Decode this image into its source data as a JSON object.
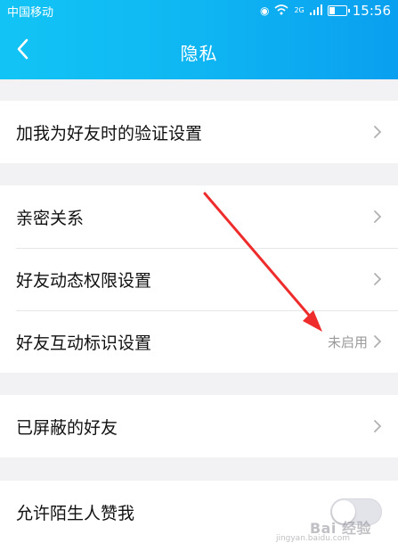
{
  "status_bar": {
    "carrier": "中国移动",
    "network": "2G",
    "time": "15:56"
  },
  "header": {
    "back_icon": "chevron-left-icon",
    "title": "隐私",
    "color_start": "#12c4f5",
    "color_end": "#0a9ff0"
  },
  "groups": [
    {
      "items": [
        {
          "label": "加我为好友时的验证设置",
          "chevron": true
        }
      ]
    },
    {
      "items": [
        {
          "label": "亲密关系",
          "chevron": true
        },
        {
          "label": "好友动态权限设置",
          "chevron": true
        },
        {
          "label": "好友互动标识设置",
          "value": "未启用",
          "chevron": true
        }
      ]
    },
    {
      "items": [
        {
          "label": "已屏蔽的好友",
          "chevron": true
        }
      ]
    },
    {
      "items": [
        {
          "label": "允许陌生人赞我",
          "toggle": "off"
        }
      ]
    }
  ],
  "annotation": {
    "type": "red-arrow",
    "color": "#ef2c2c"
  },
  "watermark": {
    "text": "Bai 经验",
    "sub": "jingyan.baidu.com"
  }
}
